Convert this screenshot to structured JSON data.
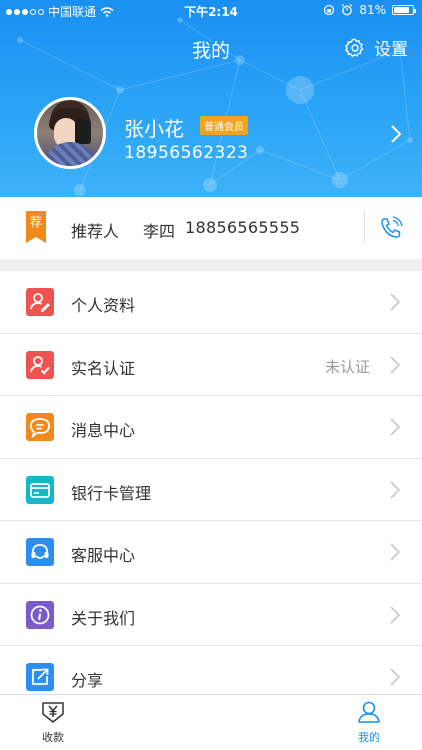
{
  "status_bar": {
    "carrier": "中国联通",
    "time": "下午2:14",
    "battery": "81%",
    "battery_level": 0.81
  },
  "header": {
    "title": "我的",
    "settings_label": "设置",
    "settings_icon": "gear-icon"
  },
  "profile": {
    "name": "张小花",
    "member_badge": "普通会员",
    "phone": "18956562323"
  },
  "referrer": {
    "badge": "荐",
    "label": "推荐人",
    "name": "李四",
    "phone": "18856565555",
    "call_icon": "phone-icon"
  },
  "menu": [
    {
      "label": "个人资料",
      "value": "",
      "icon": "profile-edit-icon",
      "color": "#ef5350"
    },
    {
      "label": "实名认证",
      "value": "未认证",
      "icon": "user-verify-icon",
      "color": "#ef5350"
    },
    {
      "label": "消息中心",
      "value": "",
      "icon": "message-icon",
      "color": "#f08a1c"
    },
    {
      "label": "银行卡管理",
      "value": "",
      "icon": "bank-card-icon",
      "color": "#14b8c8"
    },
    {
      "label": "客服中心",
      "value": "",
      "icon": "headset-icon",
      "color": "#2b8ff0"
    },
    {
      "label": "关于我们",
      "value": "",
      "icon": "info-icon",
      "color": "#7a5bc9"
    },
    {
      "label": "分享",
      "value": "",
      "icon": "share-icon",
      "color": "#2b8ff0"
    }
  ],
  "tabbar": {
    "tabs": [
      {
        "label": "收款",
        "icon": "yen-receive-icon",
        "active": false
      },
      {
        "label": "我的",
        "icon": "user-icon",
        "active": true
      }
    ],
    "active_color": "#1a8ff2"
  },
  "colors": {
    "header_blue": "#1a8ff2",
    "badge_orange": "#f3a21c"
  }
}
